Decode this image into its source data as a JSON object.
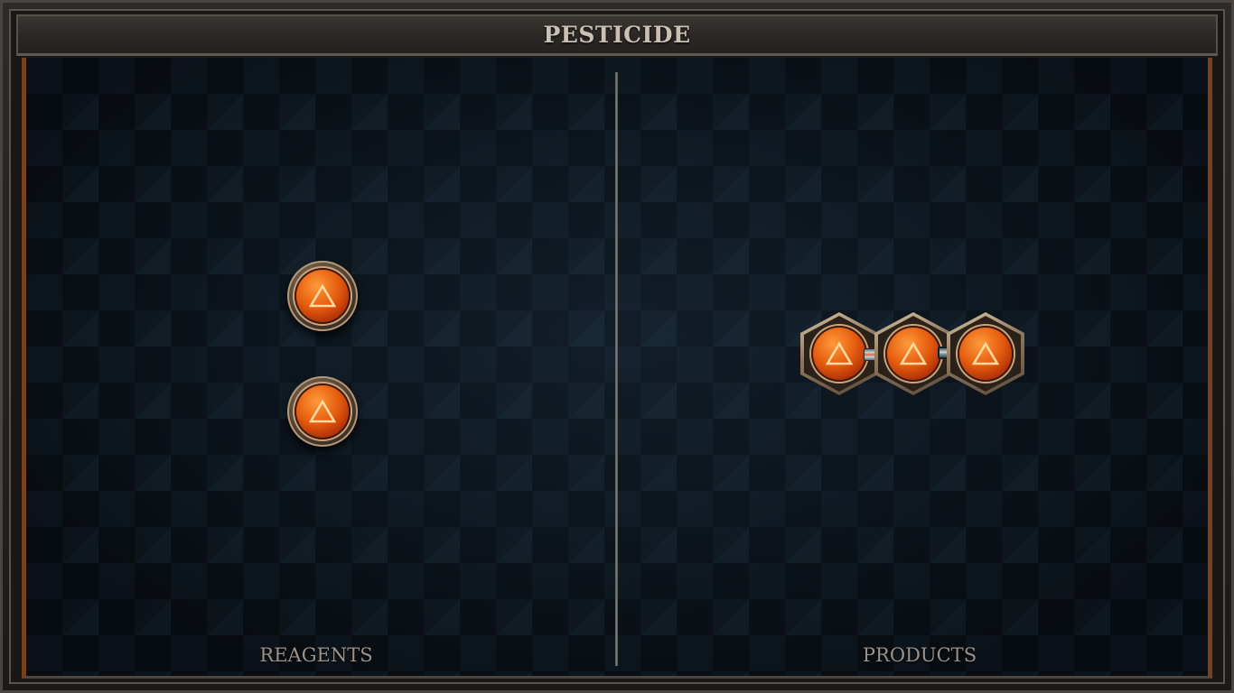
{
  "header": {
    "title": "PESTICIDE"
  },
  "reagents": {
    "label": "REAGENTS",
    "items": [
      {
        "icon": "fire-triangle-orb-icon",
        "color": "#e45a0e"
      },
      {
        "icon": "fire-triangle-orb-icon",
        "color": "#e45a0e"
      }
    ]
  },
  "products": {
    "label": "PRODUCTS",
    "chain": [
      {
        "icon": "fire-triangle-orb-icon",
        "color": "#e45a0e"
      },
      {
        "icon": "fire-triangle-orb-icon",
        "color": "#e45a0e"
      },
      {
        "icon": "fire-triangle-orb-icon",
        "color": "#e45a0e"
      }
    ],
    "bonds": [
      "wire-bond",
      "metal-bond"
    ]
  },
  "colors": {
    "accent_copper": "#7a3f1f",
    "orb_orange": "#e45a0e",
    "title_text": "#c9c0b3",
    "label_text": "#9a928a",
    "background": "#111c26"
  }
}
